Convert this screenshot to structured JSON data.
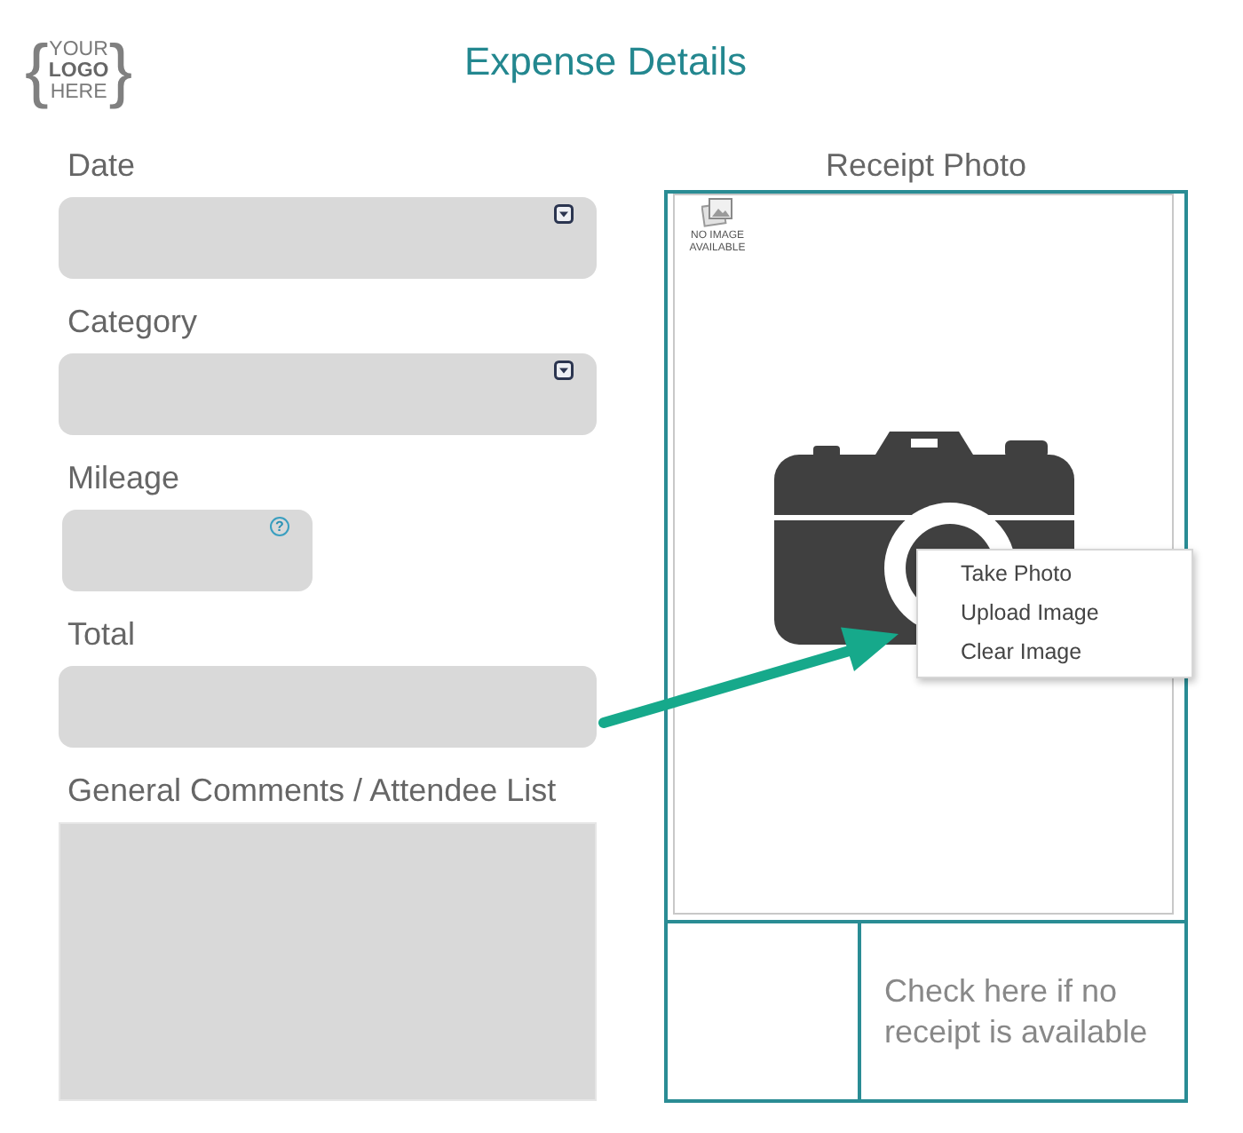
{
  "logo": {
    "brace_open": "{",
    "lines": [
      "YOUR",
      "LOGO",
      "HERE"
    ],
    "brace_close": "}"
  },
  "title": "Expense Details",
  "fields": [
    {
      "label": "Date",
      "kind": "dropdown"
    },
    {
      "label": "Category",
      "kind": "dropdown"
    },
    {
      "label": "Mileage",
      "kind": "short",
      "hint_icon": "?"
    },
    {
      "label": "Total",
      "kind": "text"
    },
    {
      "label": "General Comments / Attendee List",
      "kind": "textarea"
    }
  ],
  "receipt": {
    "label": "Receipt Photo",
    "no_image_text": "NO IMAGE AVAILABLE",
    "no_receipt_label": "Check here if no receipt is available"
  },
  "context_menu": {
    "items": [
      "Take Photo",
      "Upload Image",
      "Clear Image"
    ]
  }
}
